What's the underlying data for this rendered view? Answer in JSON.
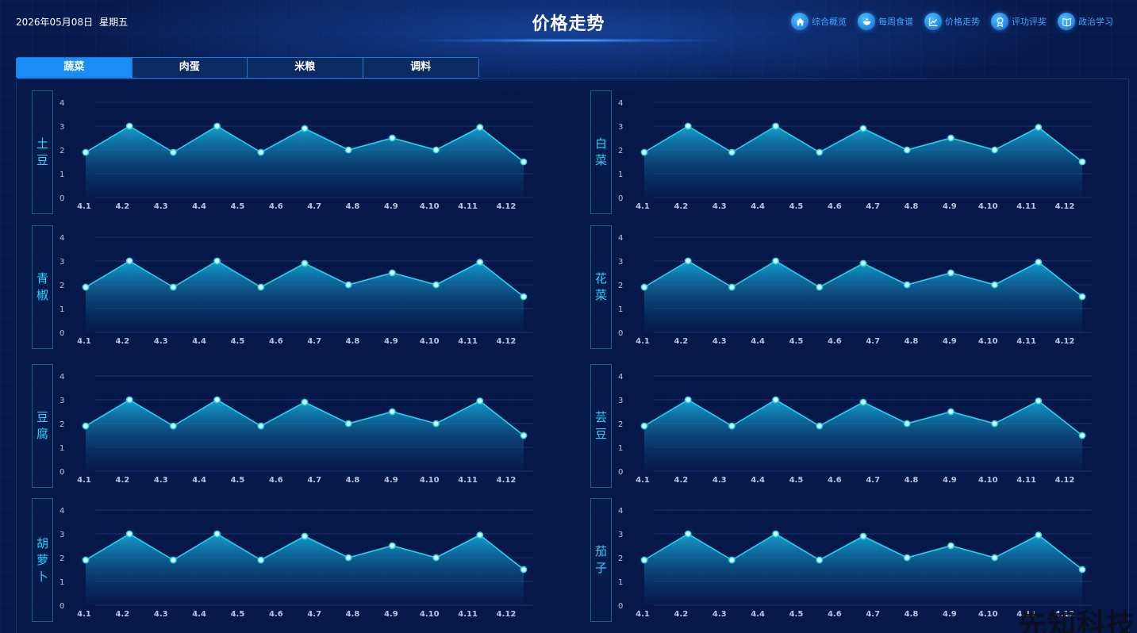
{
  "header": {
    "date": "2026年05月08日",
    "weekday": "星期五",
    "title": "价格走势",
    "nav": [
      {
        "label": "综合概览",
        "icon": "home-icon"
      },
      {
        "label": "每周食谱",
        "icon": "bowl-icon"
      },
      {
        "label": "价格走势",
        "icon": "chart-line-icon"
      },
      {
        "label": "评功评奖",
        "icon": "award-icon"
      },
      {
        "label": "政治学习",
        "icon": "book-icon"
      }
    ]
  },
  "tabs": [
    {
      "label": "蔬菜",
      "active": true
    },
    {
      "label": "肉蛋",
      "active": false
    },
    {
      "label": "米粮",
      "active": false
    },
    {
      "label": "调料",
      "active": false
    }
  ],
  "colors": {
    "accent": "#1a8cf6",
    "line": "#1fd8f0",
    "label": "#22d5ff",
    "background": "#071a4e"
  },
  "watermark": "先知科技",
  "chart_data": [
    {
      "type": "area",
      "name": "土豆",
      "categories": [
        "4.1",
        "4.2",
        "4.3",
        "4.4",
        "4.5",
        "4.6",
        "4.7",
        "4.8",
        "4.9",
        "4.10",
        "4.11",
        "4.12"
      ],
      "values": [
        1.9,
        3.0,
        1.9,
        3.0,
        1.9,
        2.9,
        2.0,
        2.5,
        2.0,
        2.95,
        1.5
      ],
      "yticks": [
        "0",
        "1",
        "2",
        "3",
        "4"
      ],
      "ylim": [
        0,
        4
      ],
      "grid": true
    },
    {
      "type": "area",
      "name": "白菜",
      "categories": [
        "4.1",
        "4.2",
        "4.3",
        "4.4",
        "4.5",
        "4.6",
        "4.7",
        "4.8",
        "4.9",
        "4.10",
        "4.11",
        "4.12"
      ],
      "values": [
        1.9,
        3.0,
        1.9,
        3.0,
        1.9,
        2.9,
        2.0,
        2.5,
        2.0,
        2.95,
        1.5
      ],
      "yticks": [
        "0",
        "1",
        "2",
        "3",
        "4"
      ],
      "ylim": [
        0,
        4
      ],
      "grid": true
    },
    {
      "type": "area",
      "name": "青椒",
      "categories": [
        "4.1",
        "4.2",
        "4.3",
        "4.4",
        "4.5",
        "4.6",
        "4.7",
        "4.8",
        "4.9",
        "4.10",
        "4.11",
        "4.12"
      ],
      "values": [
        1.9,
        3.0,
        1.9,
        3.0,
        1.9,
        2.9,
        2.0,
        2.5,
        2.0,
        2.95,
        1.5
      ],
      "yticks": [
        "0",
        "1",
        "2",
        "3",
        "4"
      ],
      "ylim": [
        0,
        4
      ],
      "grid": true
    },
    {
      "type": "area",
      "name": "花菜",
      "categories": [
        "4.1",
        "4.2",
        "4.3",
        "4.4",
        "4.5",
        "4.6",
        "4.7",
        "4.8",
        "4.9",
        "4.10",
        "4.11",
        "4.12"
      ],
      "values": [
        1.9,
        3.0,
        1.9,
        3.0,
        1.9,
        2.9,
        2.0,
        2.5,
        2.0,
        2.95,
        1.5
      ],
      "yticks": [
        "0",
        "1",
        "2",
        "3",
        "4"
      ],
      "ylim": [
        0,
        4
      ],
      "grid": true
    },
    {
      "type": "area",
      "name": "豆腐",
      "categories": [
        "4.1",
        "4.2",
        "4.3",
        "4.4",
        "4.5",
        "4.6",
        "4.7",
        "4.8",
        "4.9",
        "4.10",
        "4.11",
        "4.12"
      ],
      "values": [
        1.9,
        3.0,
        1.9,
        3.0,
        1.9,
        2.9,
        2.0,
        2.5,
        2.0,
        2.95,
        1.5
      ],
      "yticks": [
        "0",
        "1",
        "2",
        "3",
        "4"
      ],
      "ylim": [
        0,
        4
      ],
      "grid": true
    },
    {
      "type": "area",
      "name": "芸豆",
      "categories": [
        "4.1",
        "4.2",
        "4.3",
        "4.4",
        "4.5",
        "4.6",
        "4.7",
        "4.8",
        "4.9",
        "4.10",
        "4.11",
        "4.12"
      ],
      "values": [
        1.9,
        3.0,
        1.9,
        3.0,
        1.9,
        2.9,
        2.0,
        2.5,
        2.0,
        2.95,
        1.5
      ],
      "yticks": [
        "0",
        "1",
        "2",
        "3",
        "4"
      ],
      "ylim": [
        0,
        4
      ],
      "grid": true
    },
    {
      "type": "area",
      "name": "胡萝卜",
      "categories": [
        "4.1",
        "4.2",
        "4.3",
        "4.4",
        "4.5",
        "4.6",
        "4.7",
        "4.8",
        "4.9",
        "4.10",
        "4.11",
        "4.12"
      ],
      "values": [
        1.9,
        3.0,
        1.9,
        3.0,
        1.9,
        2.9,
        2.0,
        2.5,
        2.0,
        2.95,
        1.5
      ],
      "yticks": [
        "0",
        "1",
        "2",
        "3",
        "4"
      ],
      "ylim": [
        0,
        4
      ],
      "grid": true
    },
    {
      "type": "area",
      "name": "茄子",
      "categories": [
        "4.1",
        "4.2",
        "4.3",
        "4.4",
        "4.5",
        "4.6",
        "4.7",
        "4.8",
        "4.9",
        "4.10",
        "4.11",
        "4.12"
      ],
      "values": [
        1.9,
        3.0,
        1.9,
        3.0,
        1.9,
        2.9,
        2.0,
        2.5,
        2.0,
        2.95,
        1.5
      ],
      "yticks": [
        "0",
        "1",
        "2",
        "3",
        "4"
      ],
      "ylim": [
        0,
        4
      ],
      "grid": true
    }
  ]
}
